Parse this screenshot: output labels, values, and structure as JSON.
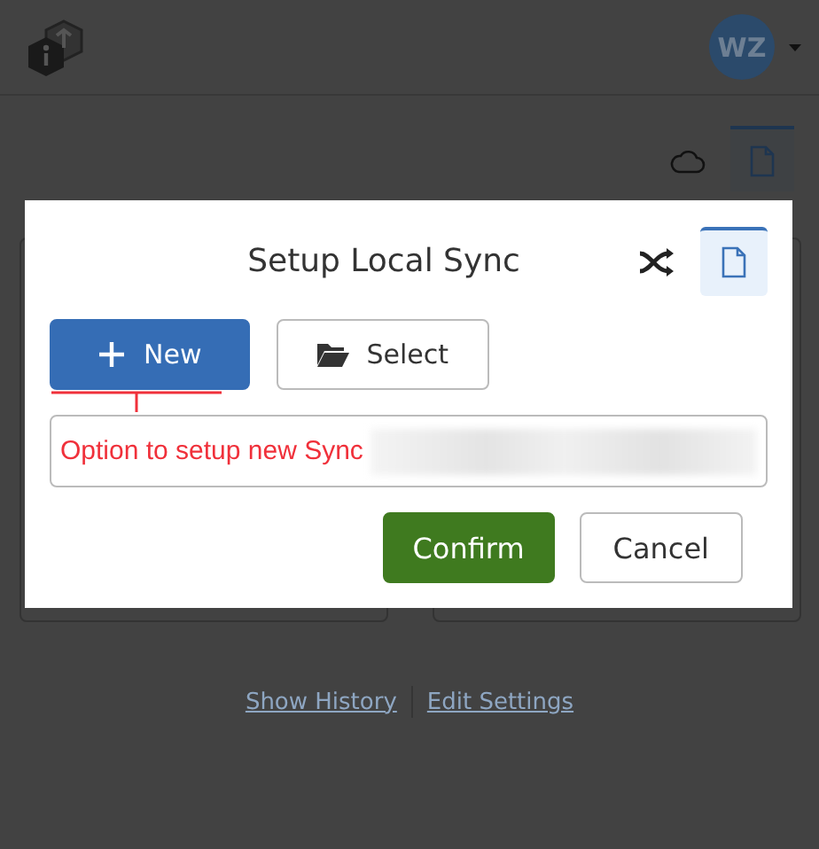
{
  "header": {
    "avatar": "WZ"
  },
  "view_tabs": [
    {
      "kind": "cloud",
      "selected": false
    },
    {
      "kind": "file",
      "selected": true
    }
  ],
  "links": [
    "Show History",
    "Edit Settings"
  ],
  "dialog": {
    "title": "Setup Local Sync",
    "mode_tabs": [
      {
        "kind": "shuffle",
        "selected": false
      },
      {
        "kind": "file",
        "selected": true
      }
    ],
    "options": [
      {
        "kind": "new",
        "label": "New",
        "selected": true
      },
      {
        "kind": "select",
        "label": "Select",
        "selected": false
      }
    ],
    "annotation": "Option to setup new Sync",
    "buttons": [
      {
        "kind": "primary",
        "label": "Confirm"
      },
      {
        "kind": "secondary",
        "label": "Cancel"
      }
    ]
  }
}
